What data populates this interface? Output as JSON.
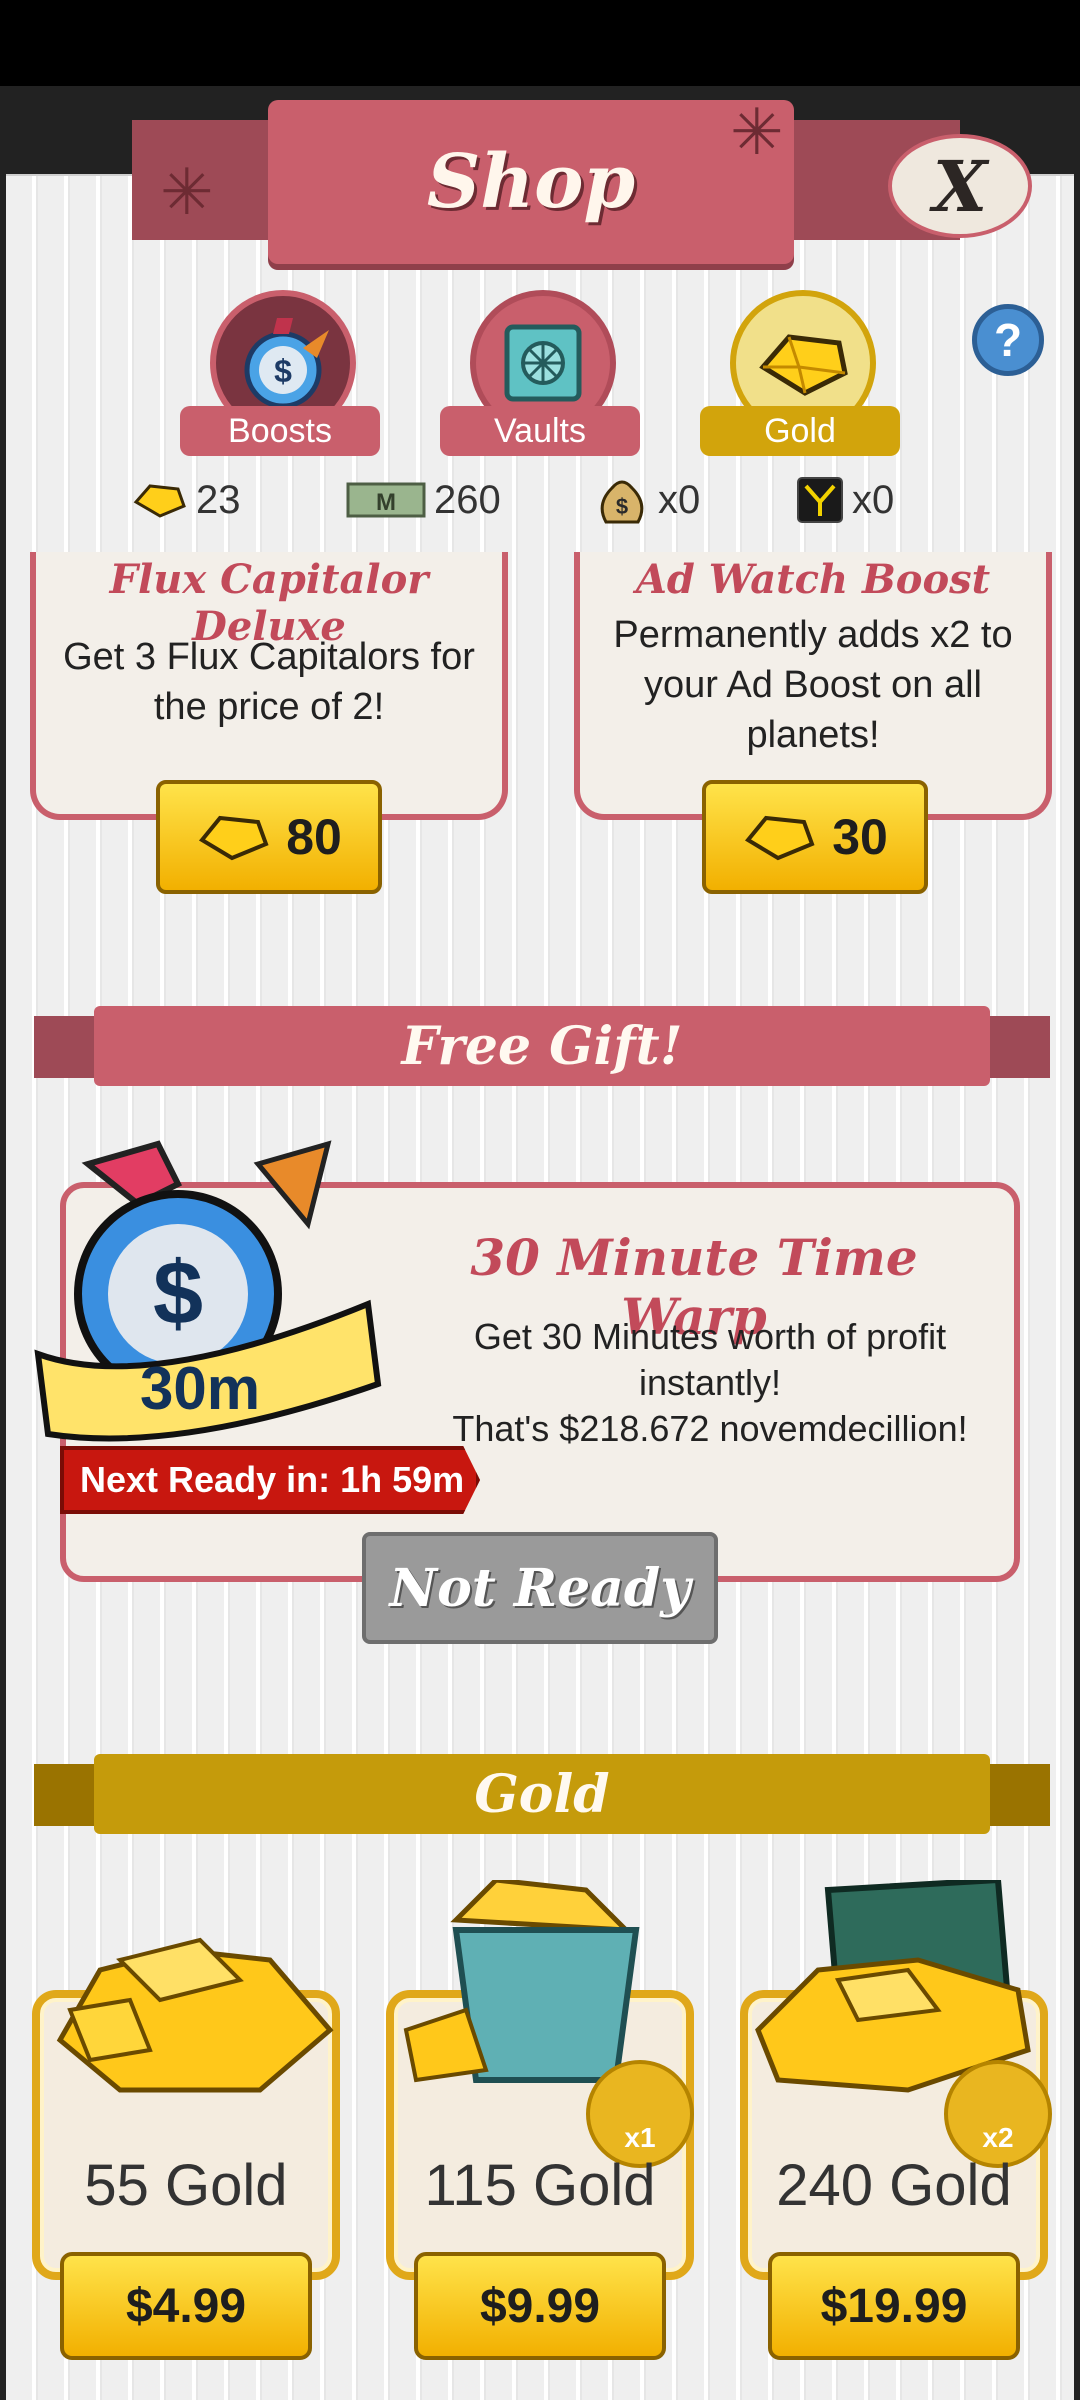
{
  "header": {
    "title": "Shop",
    "close_label": "X"
  },
  "tabs": [
    {
      "label": "Boosts",
      "icon": "stopwatch-boost-icon"
    },
    {
      "label": "Vaults",
      "icon": "vault-icon"
    },
    {
      "label": "Gold",
      "icon": "gold-gem-icon",
      "active": true
    }
  ],
  "help_label": "?",
  "currency": [
    {
      "icon": "gold-gem-icon",
      "value": "23"
    },
    {
      "icon": "megabuck-icon",
      "value": "260"
    },
    {
      "icon": "money-bag-icon",
      "value": "x0"
    },
    {
      "icon": "flux-capitalor-icon",
      "value": "x0"
    }
  ],
  "products": [
    {
      "title": "Flux Capitalor Deluxe",
      "desc": "Get 3 Flux Capitalors for the price of 2!",
      "price": "80"
    },
    {
      "title": "Ad Watch Boost",
      "desc": "Permanently adds x2 to your Ad Boost on all planets!",
      "price": "30"
    }
  ],
  "free_gift": {
    "section_title": "Free Gift!",
    "badge": "30m",
    "title": "30 Minute Time Warp",
    "desc_line1": "Get 30 Minutes worth of profit instantly!",
    "desc_line2": "That's $218.672 novemdecillion!",
    "next_ready": "Next Ready in: 1h 59m",
    "button": "Not Ready"
  },
  "gold": {
    "section_title": "Gold",
    "packs": [
      {
        "name": "55 Gold",
        "price": "$4.99",
        "multiplier": ""
      },
      {
        "name": "115 Gold",
        "price": "$9.99",
        "multiplier": "x1"
      },
      {
        "name": "240 Gold",
        "price": "$19.99",
        "multiplier": "x2"
      }
    ]
  },
  "colors": {
    "accent": "#c95f6c",
    "gold": "#f2b000",
    "gold_header": "#c59b0b"
  }
}
